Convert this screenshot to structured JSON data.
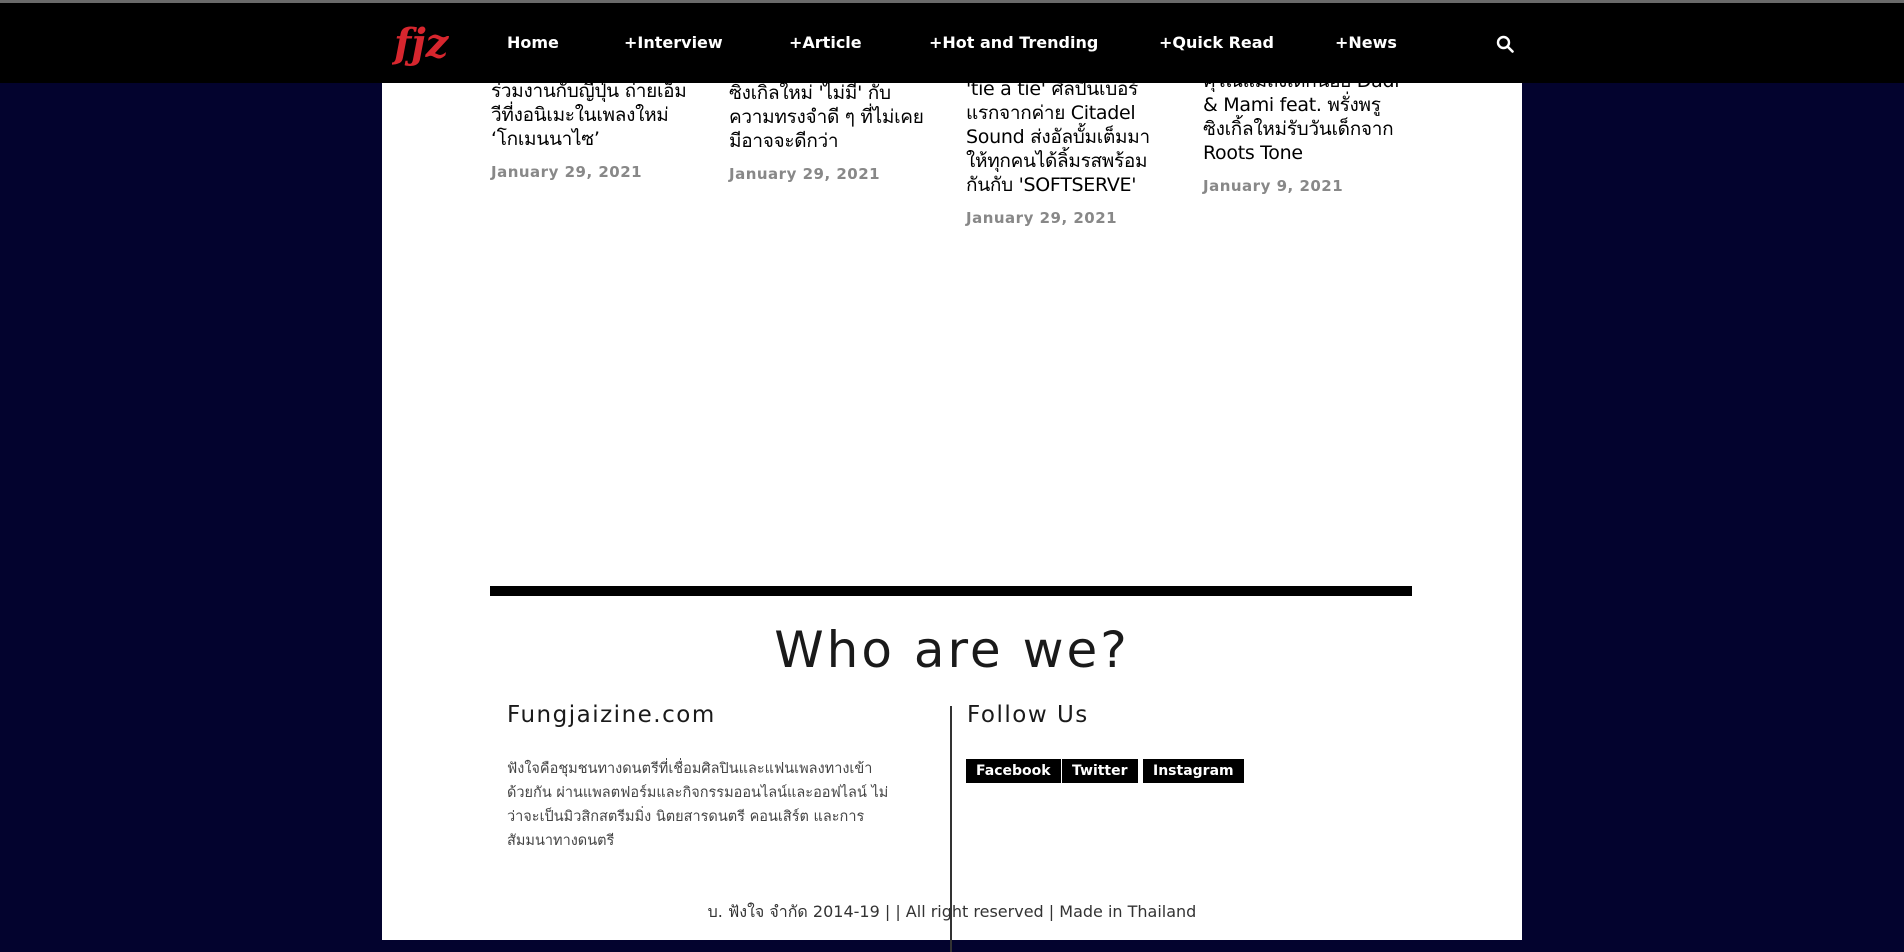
{
  "nav": {
    "logo_text": "fjz",
    "items": [
      "Home",
      "+Interview",
      "+Article",
      "+Hot and Trending",
      "+Quick Read",
      "+News"
    ]
  },
  "articles": [
    {
      "title": "ร่วมงานกับญี่ปุ่น ถ่ายเอ็มวีที่งอนิเมะในเพลงใหม่ ‘โกเมนนาไซ’",
      "date": "January 29, 2021"
    },
    {
      "title": "ซิงเกิ้ลใหม่ 'ไม่มี' กับความทรงจำดี ๆ ที่ไม่เคยมีอาจจะดีกว่า",
      "date": "January 29, 2021"
    },
    {
      "title": "'tie a tie' ศิลปินเบอร์แรกจากค่าย Citadel Sound ส่งอัลบั้มเต็มมาให้ทุกคนได้ลิ้มรสพร้อมกันกับ 'SOFTSERVE'",
      "date": "January 29, 2021"
    },
    {
      "title": "คุโณแม่ถึงเด็กน้อย Dadi & Mami feat. พรั่งพรู ซิงเกิ้ลใหม่รับวันเด็กจาก Roots Tone",
      "date": "January 9, 2021"
    }
  ],
  "about": {
    "heading": "Who are we?",
    "site_title": "Fungjaizine.com",
    "description": "ฟังใจคือชุมชนทางดนตรีที่เชื่อมศิลปินและแฟนเพลงทางเข้าด้วยกัน ผ่านแพลตฟอร์มและกิจกรรมออนไลน์และออฟไลน์ ไม่ว่าจะเป็นมิวสิกสตรีมมิ่ง นิตยสารดนตรี คอนเสิร์ต และการสัมมนาทางดนตรี",
    "follow_title": "Follow Us",
    "social": [
      "Facebook",
      "Twitter",
      "Instagram"
    ]
  },
  "footer": "บ. ฟังใจ จำกัด 2014-19 | | All right reserved | Made in Thailand",
  "colors": {
    "background": "#03032e",
    "nav": "#000000",
    "logo": "#d7262e"
  },
  "icons": [
    "logo",
    "search-icon"
  ]
}
